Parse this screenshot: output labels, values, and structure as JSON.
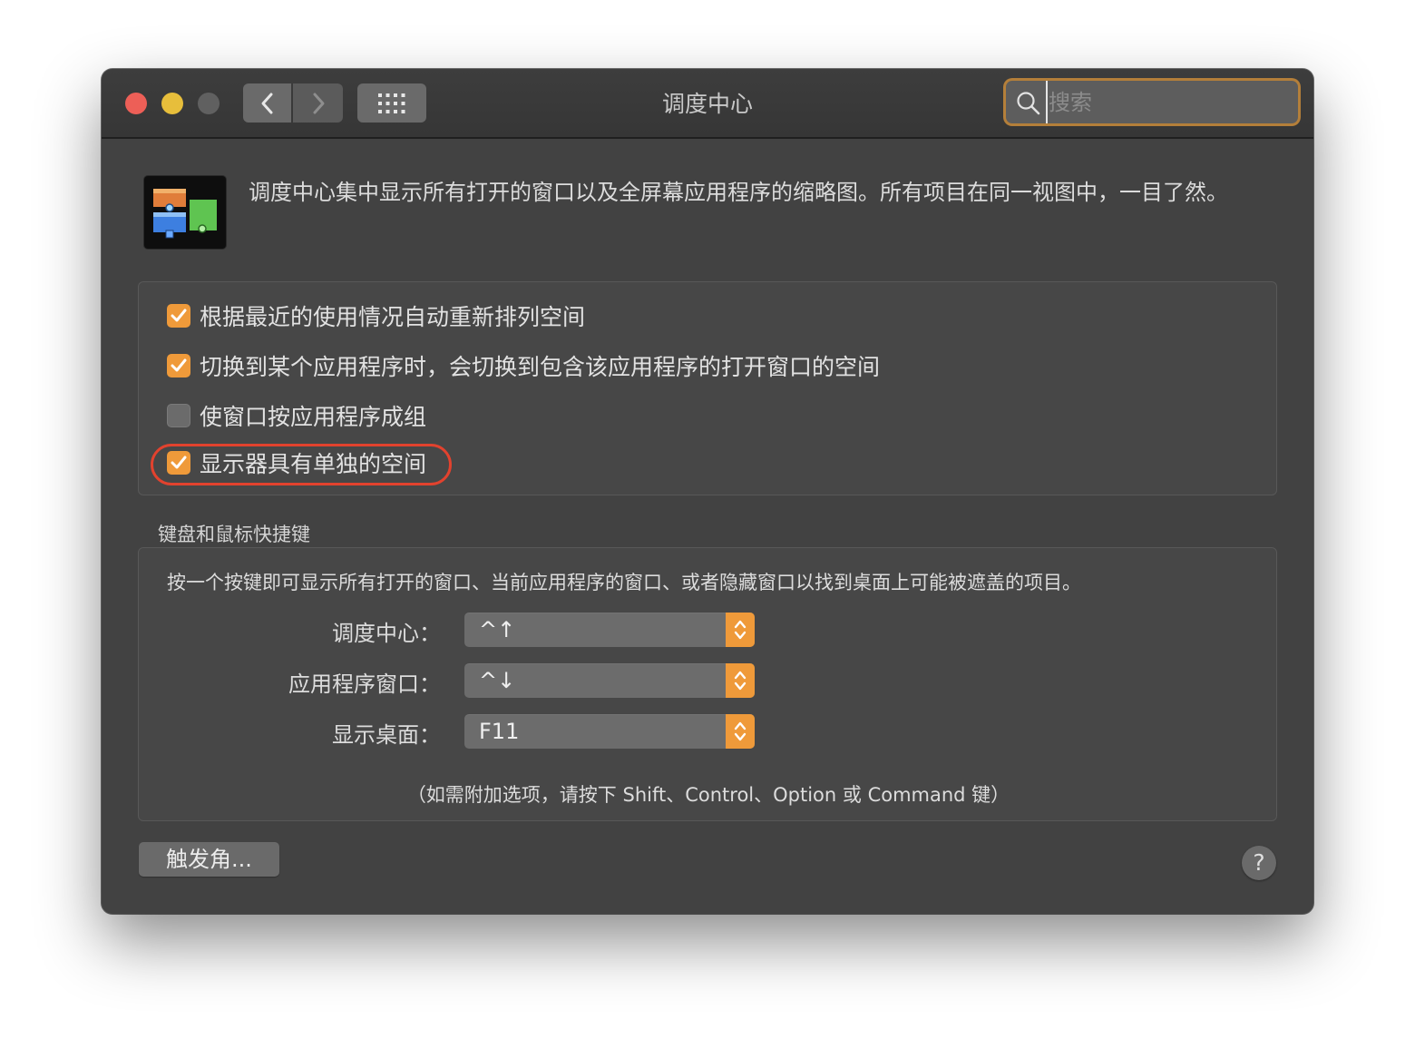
{
  "window": {
    "title": "调度中心"
  },
  "toolbar": {
    "back_icon": "chevron-left-icon",
    "forward_icon": "chevron-right-icon",
    "grid_icon": "grid-icon"
  },
  "search": {
    "placeholder": "搜索",
    "value": ""
  },
  "header": {
    "description": "调度中心集中显示所有打开的窗口以及全屏幕应用程序的缩略图。所有项目在同一视图中，一目了然。"
  },
  "options": [
    {
      "label": "根据最近的使用情况自动重新排列空间",
      "checked": true
    },
    {
      "label": "切换到某个应用程序时，会切换到包含该应用程序的打开窗口的空间",
      "checked": true
    },
    {
      "label": "使窗口按应用程序成组",
      "checked": false
    },
    {
      "label": "显示器具有单独的空间",
      "checked": true
    }
  ],
  "shortcuts": {
    "section_title": "键盘和鼠标快捷键",
    "description": "按一个按键即可显示所有打开的窗口、当前应用程序的窗口、或者隐藏窗口以找到桌面上可能被遮盖的项目。",
    "rows": [
      {
        "label": "调度中心：",
        "value": "^↑"
      },
      {
        "label": "应用程序窗口：",
        "value": "^↓"
      },
      {
        "label": "显示桌面：",
        "value": "F11"
      }
    ],
    "hint": "（如需附加选项，请按下 Shift、Control、Option 或 Command 键）"
  },
  "footer": {
    "hot_corners_label": "触发角...",
    "help_label": "?"
  },
  "colors": {
    "accent": "#ef9a3a",
    "highlight_ring": "#e2422e",
    "window_bg": "#424242"
  }
}
